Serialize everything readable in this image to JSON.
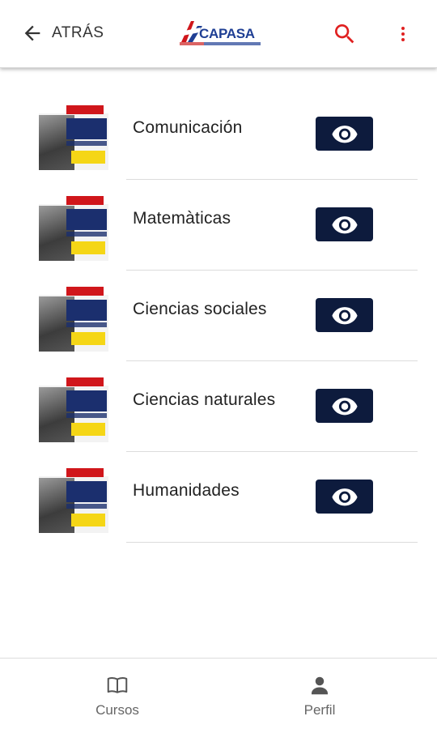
{
  "header": {
    "back_label": "ATRÁS",
    "logo_text": "CAPASA"
  },
  "courses": [
    {
      "name": "Comunicación"
    },
    {
      "name": "Matemàticas"
    },
    {
      "name": "Ciencias sociales"
    },
    {
      "name": "Ciencias naturales"
    },
    {
      "name": "Humanidades"
    }
  ],
  "bottom_nav": {
    "items": [
      {
        "label": "Cursos",
        "icon": "book-icon"
      },
      {
        "label": "Perfil",
        "icon": "person-icon"
      }
    ]
  },
  "colors": {
    "accent_red": "#e02020",
    "button_navy": "#0d1b3d",
    "brand_blue": "#1f3f94"
  }
}
